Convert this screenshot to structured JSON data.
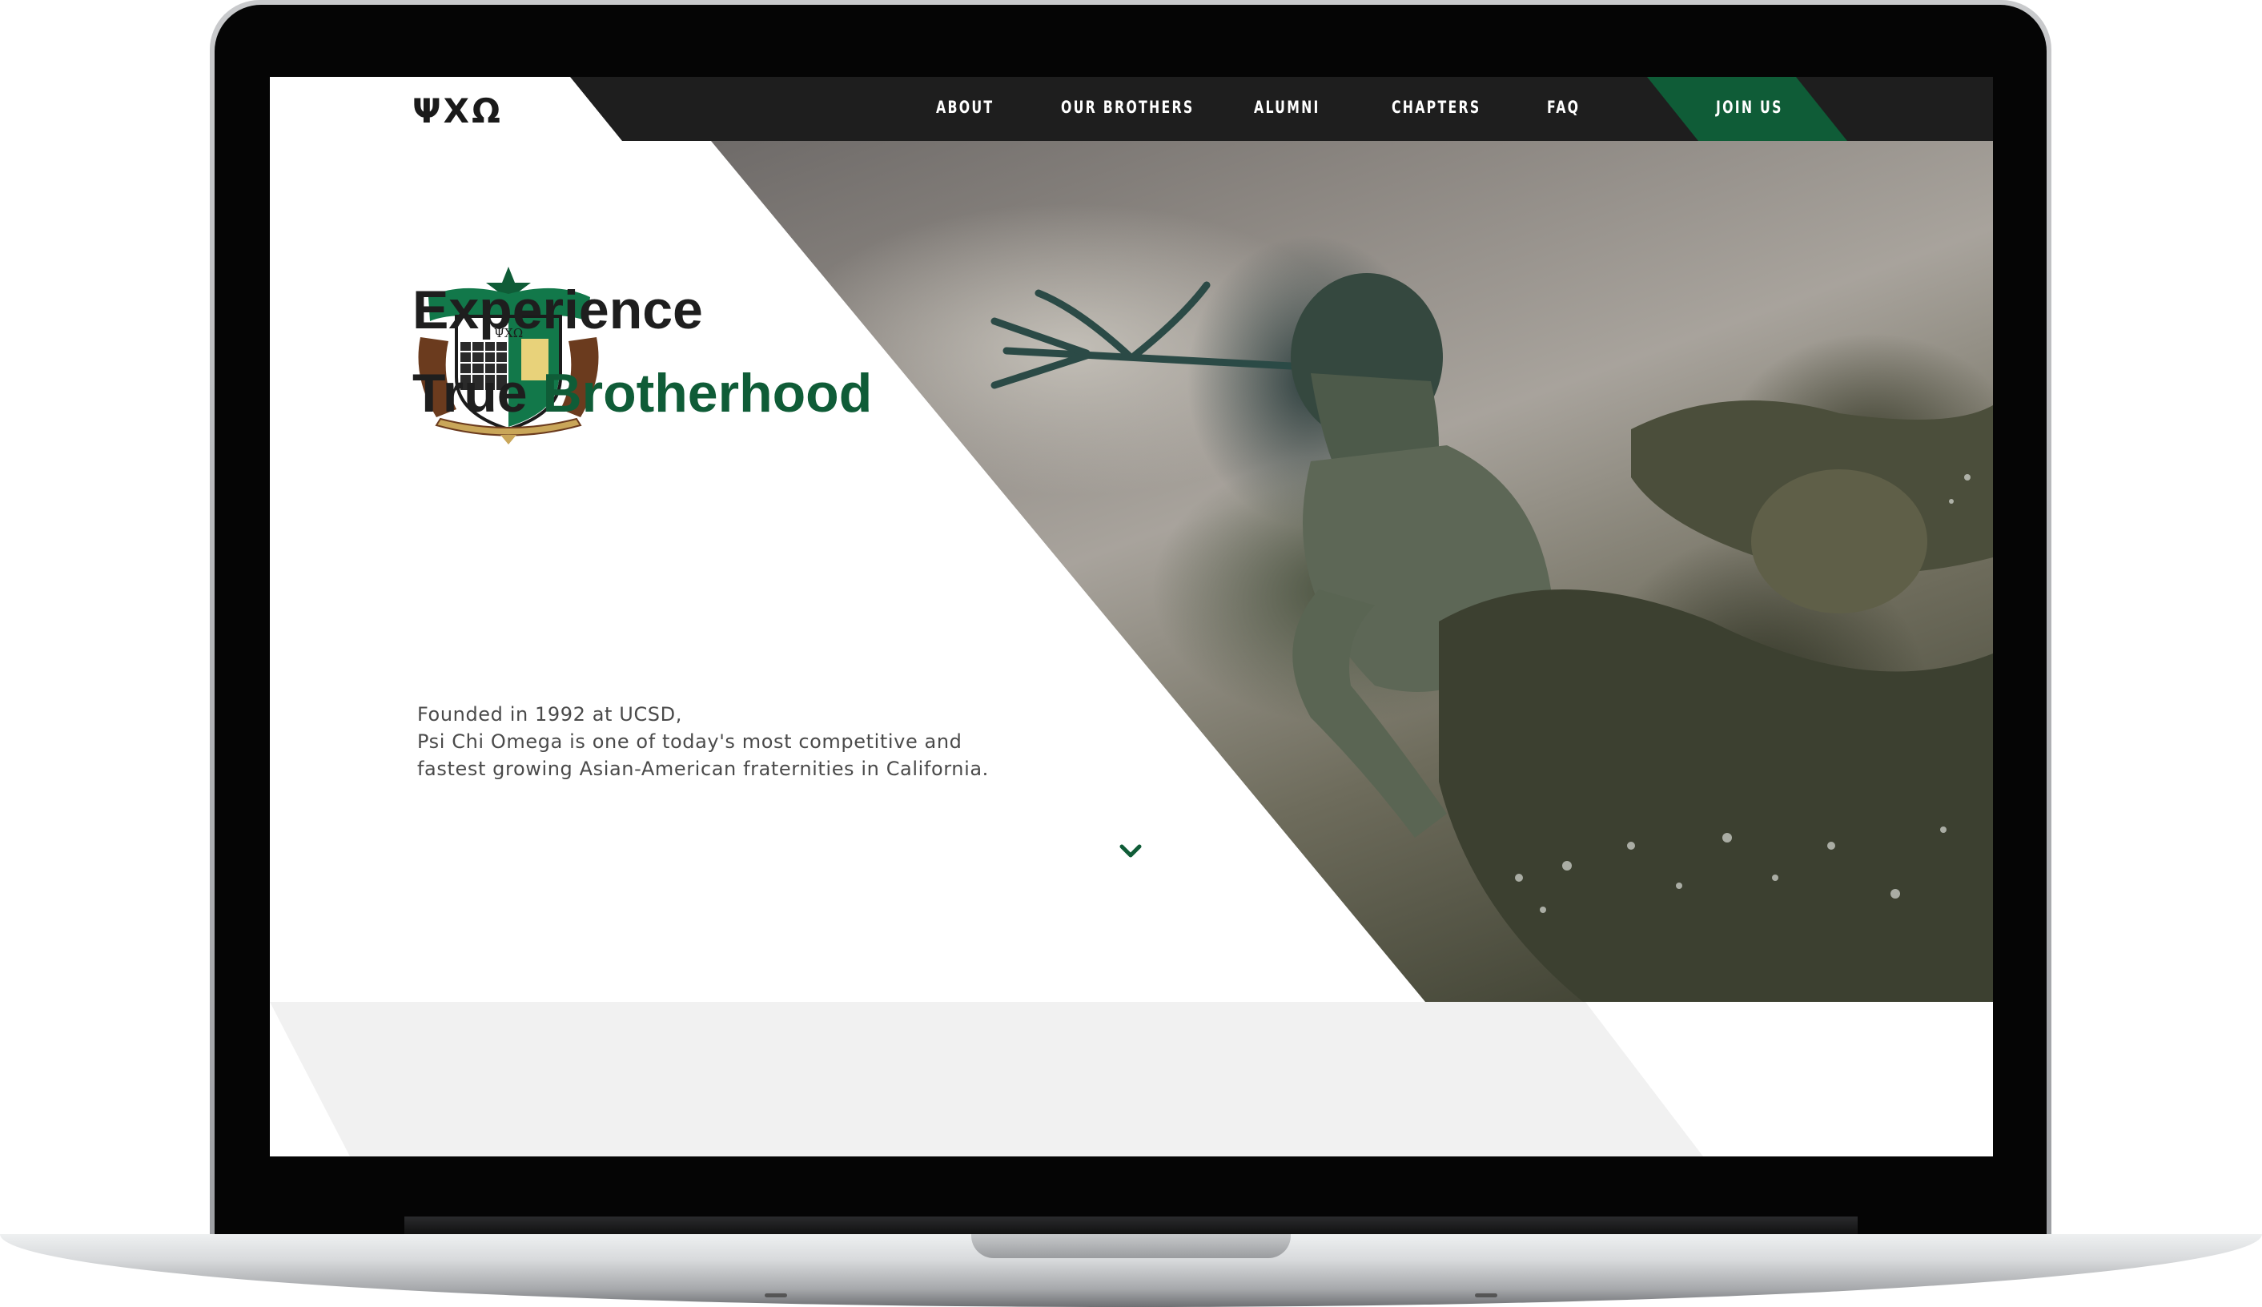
{
  "brand": {
    "logo_text": "ΨΧΩ"
  },
  "nav": {
    "items": [
      {
        "label": "ABOUT"
      },
      {
        "label": "OUR BROTHERS"
      },
      {
        "label": "ALUMNI"
      },
      {
        "label": "CHAPTERS"
      },
      {
        "label": "FAQ"
      }
    ],
    "cta_label": "JOIN US"
  },
  "hero": {
    "headline_line1": "Experience",
    "headline_line2_plain": "True",
    "headline_line2_accent": "Brotherhood",
    "description_lines": [
      "Founded in 1992 at UCSD,",
      "Psi Chi Omega is one of today's most competitive and",
      "fastest growing Asian-American fraternities in California."
    ],
    "scroll_icon": "chevron-down-icon",
    "image_subject": "poseidon-statue-photo"
  },
  "crest": {
    "letters": "ΨΧΩ"
  },
  "colors": {
    "accent_green": "#0f5c37",
    "nav_background": "#1e1e1e",
    "text_dark": "#1e1e1e",
    "section_grey": "#f1f1f1"
  }
}
